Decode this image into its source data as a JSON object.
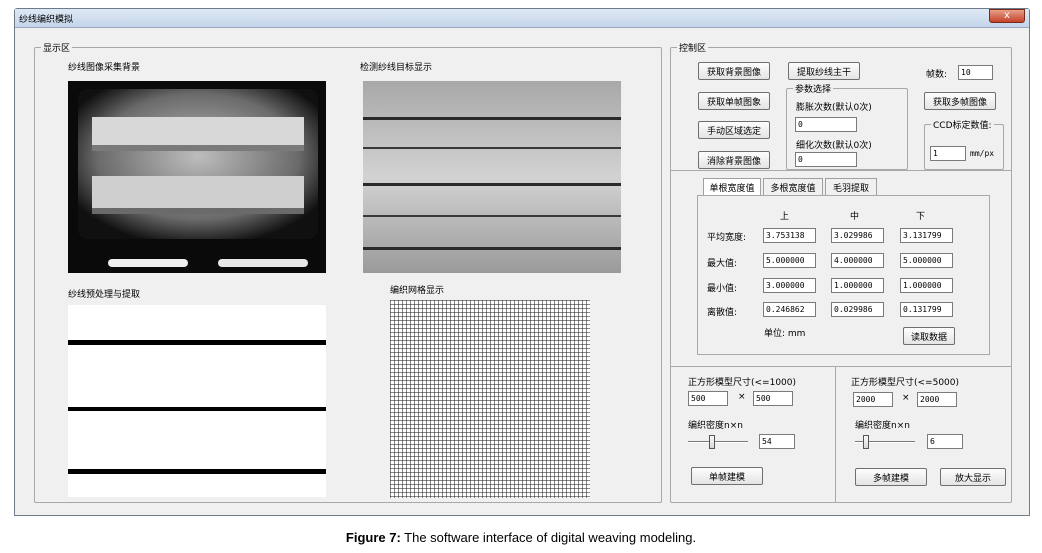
{
  "window": {
    "title": "纱线编织模拟",
    "close_glyph": "x"
  },
  "display": {
    "group_label": "显示区",
    "img1_label": "纱线图像采集背景",
    "img2_label": "检测纱线目标显示",
    "img3_label": "纱线预处理与提取",
    "img4_label": "编织网格显示"
  },
  "control": {
    "group_label": "控制区",
    "btn_get_bg": "获取背景图像",
    "btn_extract": "提取纱线主干",
    "frames_label": "帧数:",
    "frames_value": "10",
    "btn_single": "获取单帧图象",
    "btn_manual": "手动区域选定",
    "btn_clear_bg": "消除背景图像",
    "btn_multi": "获取多帧图像",
    "params": {
      "label": "参数选择",
      "dilate_label": "膨胀次数(默认0次)",
      "dilate_value": "0",
      "thin_label": "细化次数(默认0次)",
      "thin_value": "0"
    },
    "ccd": {
      "label": "CCD标定数值:",
      "value": "1",
      "unit": "mm/px"
    }
  },
  "tabs": {
    "t1": "单根宽度值",
    "t2": "多根宽度值",
    "t3": "毛羽提取"
  },
  "width_table": {
    "col_top": "上",
    "col_mid": "中",
    "col_bot": "下",
    "r1": {
      "label": "平均宽度:",
      "top": "3.753138",
      "mid": "3.029986",
      "bot": "3.131799"
    },
    "r2": {
      "label": "最大值:",
      "top": "5.000000",
      "mid": "4.000000",
      "bot": "5.000000"
    },
    "r3": {
      "label": "最小值:",
      "top": "3.000000",
      "mid": "1.000000",
      "bot": "1.000000"
    },
    "r4": {
      "label": "离散值:",
      "top": "0.246862",
      "mid": "0.029986",
      "bot": "0.131799"
    },
    "unit": "单位: mm",
    "btn_read": "读取数据"
  },
  "model_left": {
    "size_label": "正方形模型尺寸(<=1000)",
    "w": "500",
    "x": "×",
    "h": "500",
    "density_label": "编织密度n×n",
    "density_value": "54",
    "btn": "单帧建模"
  },
  "model_right": {
    "size_label": "正方形模型尺寸(<=5000)",
    "w": "2000",
    "x": "×",
    "h": "2000",
    "density_label": "编织密度n×n",
    "density_value": "6",
    "btn_model": "多帧建模",
    "btn_zoom": "放大显示"
  },
  "caption": {
    "bold": "Figure 7:",
    "text": " The software interface of digital weaving modeling."
  }
}
